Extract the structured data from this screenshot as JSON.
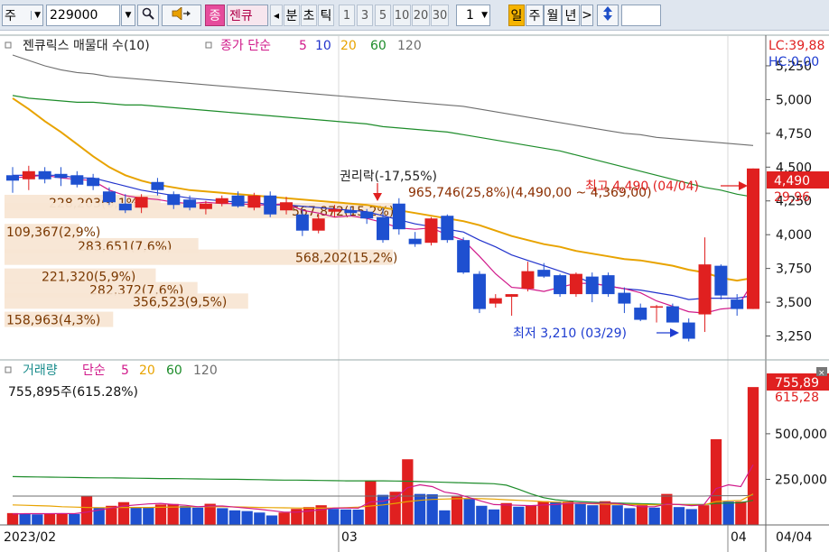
{
  "toolbar": {
    "market": "주",
    "code": "229000",
    "tab_active": "종",
    "name_short": "젠큐",
    "arrow_left": "◂",
    "tick_labels": [
      "분",
      "초",
      "틱"
    ],
    "intervals": [
      "1",
      "3",
      "5",
      "10",
      "20",
      "30"
    ],
    "count": "1",
    "periods": [
      "일",
      "주",
      "월",
      "년"
    ],
    "arrow_right": ">"
  },
  "legend": {
    "title": "젠큐릭스 매물대 수(10)",
    "ma_title": "종가 단순",
    "periods": [
      "5",
      "10",
      "20",
      "60",
      "120"
    ],
    "period_colors": [
      "#d0198a",
      "#2233cc",
      "#e8a300",
      "#1d8c2a",
      "#6e6e6e"
    ]
  },
  "volume_legend": {
    "title": "거래량",
    "ma_title": "단순",
    "periods": [
      "5",
      "20",
      "60",
      "120"
    ],
    "summary": "755,895주(615.28%)"
  },
  "price_axis": {
    "labels": [
      "5,250",
      "5,000",
      "4,750",
      "4,500",
      "4,250",
      "4,000",
      "3,750",
      "3,500",
      "3,250"
    ],
    "lc": "LC:39,88",
    "hc": "HC:0,00",
    "current": "4,490",
    "change": "29,96"
  },
  "volume_axis": {
    "labels": [
      "500,000",
      "250,000"
    ],
    "current": "755,89",
    "ratio": "615,28"
  },
  "date_axis": {
    "labels": [
      "2023/02",
      "03",
      "04",
      "04/04"
    ]
  },
  "annotations": {
    "rights": "권리락(-17,55%)",
    "max": "최고 4,490 (04/04)",
    "min": "최저 3,210 (03/29)",
    "max_volume": "965,746(25,8%)(4,490,00 ~ 4,369,00)"
  },
  "chart_data": {
    "type": "candlestick",
    "ylim": [
      3080,
      5470
    ],
    "volume_lim": [
      0,
      900000
    ],
    "candles": [
      {
        "o": 4440,
        "h": 4500,
        "l": 4310,
        "c": 4400
      },
      {
        "o": 4410,
        "h": 4510,
        "l": 4330,
        "c": 4470
      },
      {
        "o": 4470,
        "h": 4500,
        "l": 4380,
        "c": 4410
      },
      {
        "o": 4450,
        "h": 4500,
        "l": 4360,
        "c": 4420
      },
      {
        "o": 4440,
        "h": 4470,
        "l": 4350,
        "c": 4370
      },
      {
        "o": 4420,
        "h": 4450,
        "l": 4330,
        "c": 4360
      },
      {
        "o": 4320,
        "h": 4350,
        "l": 4220,
        "c": 4240
      },
      {
        "o": 4230,
        "h": 4300,
        "l": 4160,
        "c": 4180
      },
      {
        "o": 4200,
        "h": 4300,
        "l": 4160,
        "c": 4280
      },
      {
        "o": 4390,
        "h": 4420,
        "l": 4290,
        "c": 4330
      },
      {
        "o": 4300,
        "h": 4320,
        "l": 4190,
        "c": 4220
      },
      {
        "o": 4260,
        "h": 4290,
        "l": 4180,
        "c": 4200
      },
      {
        "o": 4190,
        "h": 4250,
        "l": 4150,
        "c": 4230
      },
      {
        "o": 4230,
        "h": 4290,
        "l": 4210,
        "c": 4270
      },
      {
        "o": 4290,
        "h": 4320,
        "l": 4200,
        "c": 4210
      },
      {
        "o": 4200,
        "h": 4310,
        "l": 4180,
        "c": 4290
      },
      {
        "o": 4290,
        "h": 4320,
        "l": 4130,
        "c": 4150
      },
      {
        "o": 4180,
        "h": 4280,
        "l": 4150,
        "c": 4240
      },
      {
        "o": 4150,
        "h": 4190,
        "l": 3990,
        "c": 4030
      },
      {
        "o": 4030,
        "h": 4150,
        "l": 4010,
        "c": 4120
      },
      {
        "o": 4170,
        "h": 4220,
        "l": 4130,
        "c": 4190
      },
      {
        "o": 4180,
        "h": 4210,
        "l": 4140,
        "c": 4160
      },
      {
        "o": 4170,
        "h": 4190,
        "l": 4080,
        "c": 4120
      },
      {
        "o": 4130,
        "h": 4200,
        "l": 3940,
        "c": 3960
      },
      {
        "o": 4230,
        "h": 4270,
        "l": 4000,
        "c": 4040
      },
      {
        "o": 3970,
        "h": 4020,
        "l": 3910,
        "c": 3930
      },
      {
        "o": 3940,
        "h": 4130,
        "l": 3920,
        "c": 4120
      },
      {
        "o": 4140,
        "h": 4150,
        "l": 3940,
        "c": 3960
      },
      {
        "o": 3960,
        "h": 3980,
        "l": 3710,
        "c": 3720
      },
      {
        "o": 3710,
        "h": 3730,
        "l": 3420,
        "c": 3450
      },
      {
        "o": 3490,
        "h": 3560,
        "l": 3460,
        "c": 3530
      },
      {
        "o": 3540,
        "h": 3560,
        "l": 3400,
        "c": 3560
      },
      {
        "o": 3600,
        "h": 3800,
        "l": 3580,
        "c": 3730
      },
      {
        "o": 3740,
        "h": 3790,
        "l": 3680,
        "c": 3690
      },
      {
        "o": 3700,
        "h": 3710,
        "l": 3540,
        "c": 3560
      },
      {
        "o": 3560,
        "h": 3720,
        "l": 3540,
        "c": 3710
      },
      {
        "o": 3690,
        "h": 3720,
        "l": 3500,
        "c": 3560
      },
      {
        "o": 3700,
        "h": 3720,
        "l": 3540,
        "c": 3560
      },
      {
        "o": 3570,
        "h": 3610,
        "l": 3420,
        "c": 3490
      },
      {
        "o": 3460,
        "h": 3490,
        "l": 3360,
        "c": 3370
      },
      {
        "o": 3460,
        "h": 3480,
        "l": 3350,
        "c": 3470
      },
      {
        "o": 3470,
        "h": 3490,
        "l": 3350,
        "c": 3350
      },
      {
        "o": 3350,
        "h": 3380,
        "l": 3210,
        "c": 3230
      },
      {
        "o": 3410,
        "h": 3980,
        "l": 3280,
        "c": 3780
      },
      {
        "o": 3770,
        "h": 3780,
        "l": 3520,
        "c": 3550
      },
      {
        "o": 3520,
        "h": 3560,
        "l": 3400,
        "c": 3450
      },
      {
        "o": 3450,
        "h": 4490,
        "l": 3450,
        "c": 4490
      }
    ],
    "ma5": [
      4420,
      4430,
      4440,
      4420,
      4410,
      4400,
      4330,
      4290,
      4270,
      4260,
      4240,
      4230,
      4240,
      4230,
      4230,
      4220,
      4220,
      4230,
      4180,
      4160,
      4130,
      4140,
      4120,
      4090,
      4050,
      4040,
      4050,
      4000,
      3960,
      3840,
      3710,
      3610,
      3600,
      3580,
      3610,
      3640,
      3640,
      3620,
      3600,
      3570,
      3510,
      3470,
      3430,
      3420,
      3450,
      3460,
      3650
    ],
    "ma10": [
      4440,
      4440,
      4440,
      4440,
      4420,
      4420,
      4390,
      4360,
      4330,
      4310,
      4290,
      4270,
      4260,
      4250,
      4240,
      4240,
      4220,
      4220,
      4210,
      4200,
      4190,
      4180,
      4170,
      4140,
      4110,
      4080,
      4060,
      4040,
      4020,
      3960,
      3910,
      3850,
      3810,
      3770,
      3730,
      3690,
      3640,
      3620,
      3600,
      3590,
      3570,
      3550,
      3520,
      3530,
      3530,
      3530,
      3550
    ],
    "ma20": [
      5010,
      4930,
      4840,
      4760,
      4670,
      4580,
      4500,
      4440,
      4400,
      4370,
      4350,
      4330,
      4320,
      4310,
      4300,
      4290,
      4280,
      4270,
      4260,
      4250,
      4240,
      4230,
      4220,
      4200,
      4180,
      4160,
      4140,
      4120,
      4100,
      4070,
      4030,
      3990,
      3960,
      3930,
      3910,
      3880,
      3860,
      3840,
      3820,
      3810,
      3790,
      3770,
      3740,
      3720,
      3680,
      3660,
      3680
    ],
    "ma60": [
      5030,
      5010,
      5000,
      4990,
      4980,
      4980,
      4970,
      4960,
      4960,
      4950,
      4940,
      4930,
      4920,
      4910,
      4900,
      4890,
      4880,
      4870,
      4860,
      4850,
      4840,
      4830,
      4820,
      4800,
      4790,
      4780,
      4770,
      4760,
      4740,
      4720,
      4700,
      4680,
      4660,
      4640,
      4620,
      4590,
      4560,
      4530,
      4500,
      4470,
      4440,
      4410,
      4380,
      4350,
      4330,
      4300,
      4280
    ],
    "ma120": [
      5330,
      5290,
      5250,
      5220,
      5200,
      5190,
      5170,
      5160,
      5150,
      5140,
      5130,
      5120,
      5110,
      5100,
      5090,
      5080,
      5070,
      5060,
      5050,
      5040,
      5030,
      5020,
      5010,
      5000,
      4990,
      4980,
      4970,
      4960,
      4950,
      4930,
      4910,
      4890,
      4870,
      4850,
      4830,
      4810,
      4790,
      4770,
      4750,
      4740,
      4720,
      4710,
      4700,
      4690,
      4680,
      4670,
      4660
    ],
    "volume": [
      65000,
      60000,
      58000,
      60000,
      62000,
      60000,
      160000,
      95000,
      105000,
      125000,
      96000,
      95000,
      112000,
      115000,
      104000,
      95000,
      116000,
      92000,
      80000,
      76000,
      68000,
      52000,
      68000,
      88000,
      98000,
      108000,
      88000,
      85000,
      84000,
      240000,
      165000,
      182000,
      360000,
      170000,
      168000,
      80000,
      155000,
      145000,
      105000,
      85000,
      120000,
      100000,
      105000,
      130000,
      128000,
      128000,
      115000,
      108000,
      130000,
      108000,
      92000,
      108000,
      95000,
      170000,
      98000,
      87000,
      108000,
      470000,
      128000,
      128000,
      755895
    ],
    "volume_ma5": [
      60000,
      62000,
      62000,
      62000,
      63000,
      62000,
      70000,
      82000,
      92000,
      104000,
      110000,
      115000,
      118000,
      112000,
      108000,
      100000,
      104000,
      104000,
      98000,
      92000,
      86000,
      78000,
      70000,
      70000,
      76000,
      84000,
      92000,
      93000,
      92000,
      126000,
      130000,
      148000,
      204000,
      220000,
      210000,
      180000,
      170000,
      150000,
      130000,
      112000,
      110000,
      108000,
      106000,
      110000,
      112000,
      118000,
      120000,
      118000,
      120000,
      118000,
      108000,
      100000,
      100000,
      114000,
      112000,
      106000,
      110000,
      200000,
      220000,
      210000,
      330000
    ],
    "volume_ma20": [
      110000,
      108000,
      106000,
      104000,
      100000,
      98000,
      96000,
      95000,
      95000,
      96000,
      96000,
      96000,
      97000,
      98000,
      99000,
      100000,
      100000,
      100000,
      99000,
      98000,
      96000,
      95000,
      94000,
      93000,
      92000,
      92000,
      93000,
      95000,
      98000,
      104000,
      110000,
      118000,
      128000,
      135000,
      140000,
      142000,
      144000,
      145000,
      144000,
      142000,
      138000,
      135000,
      132000,
      128000,
      125000,
      122000,
      118000,
      116000,
      114000,
      113000,
      112000,
      112000,
      110000,
      112000,
      112000,
      110000,
      110000,
      128000,
      132000,
      134000,
      170000
    ],
    "volume_ma60": [
      265000,
      264000,
      263000,
      262000,
      261000,
      260000,
      259000,
      258000,
      258000,
      257000,
      256000,
      255000,
      254000,
      254000,
      253000,
      252000,
      251000,
      250000,
      250000,
      249000,
      248000,
      247000,
      246000,
      246000,
      245000,
      244000,
      243000,
      242000,
      242000,
      242000,
      242000,
      241000,
      240000,
      238000,
      236000,
      234000,
      232000,
      230000,
      228000,
      226000,
      218000,
      196000,
      170000,
      150000,
      138000,
      132000,
      128000,
      125000,
      122000,
      120000,
      118000,
      116000,
      114000,
      112000,
      112000,
      112000,
      112000,
      118000,
      120000,
      122000,
      135000
    ],
    "volume_ma120": [
      158000,
      158000,
      158000,
      158000,
      158000,
      158000,
      158000,
      158000,
      158000,
      158000,
      158000,
      158000,
      158000,
      158000,
      158000,
      158000,
      158000,
      158000,
      158000,
      158000,
      158000,
      158000,
      158000,
      158000,
      158000,
      158000,
      158000,
      158000,
      158000,
      158000,
      158000,
      158000,
      158000,
      158000,
      158000,
      158000,
      158000,
      158000,
      158000,
      158000,
      158000,
      158000,
      158000,
      158000,
      158000,
      158000,
      158000,
      158000,
      158000,
      158000,
      158000,
      158000,
      158000,
      158000,
      158000,
      158000,
      158000,
      160000,
      160000,
      160000,
      162000
    ],
    "volume_profile": [
      {
        "label": "228,203(6,1%)",
        "volume": 228203
      },
      {
        "label": "109,367(2,9%)",
        "volume": 109367
      },
      {
        "label": "283,651(7,6%)",
        "volume": 283651
      },
      {
        "label": "568,202(15,2%)",
        "volume": 568202
      },
      {
        "label": "221,320(5,9%)",
        "volume": 221320
      },
      {
        "label": "282,372(7,6%)",
        "volume": 282372
      },
      {
        "label": "356,523(9,5%)",
        "volume": 356523
      },
      {
        "label": "158,963(4,3%)",
        "volume": 158963
      },
      {
        "label": "567,872(15,2%)",
        "volume": 567872
      }
    ]
  }
}
